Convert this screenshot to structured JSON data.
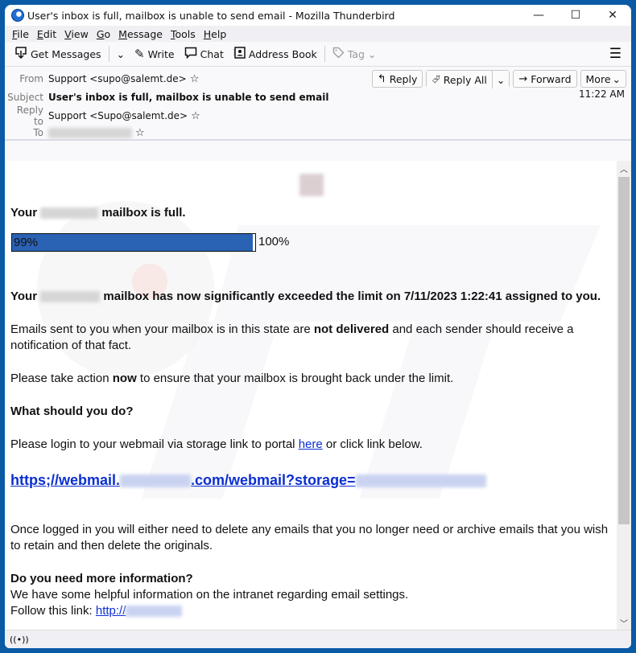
{
  "window": {
    "title": "User's inbox is full, mailbox is unable to send email - Mozilla Thunderbird",
    "controls": {
      "minimize": "—",
      "maximize": "☐",
      "close": "✕"
    }
  },
  "menubar": [
    {
      "label": "File",
      "accel": "F",
      "rest": "ile"
    },
    {
      "label": "Edit",
      "accel": "E",
      "rest": "dit"
    },
    {
      "label": "View",
      "accel": "V",
      "rest": "iew"
    },
    {
      "label": "Go",
      "accel": "G",
      "rest": "o"
    },
    {
      "label": "Message",
      "accel": "M",
      "rest": "essage"
    },
    {
      "label": "Tools",
      "accel": "T",
      "rest": "ools"
    },
    {
      "label": "Help",
      "accel": "H",
      "rest": "elp"
    }
  ],
  "toolbar": {
    "get_messages": "Get Messages",
    "write": "Write",
    "chat": "Chat",
    "address_book": "Address Book",
    "tag": "Tag"
  },
  "header": {
    "from_label": "From",
    "from_value": "Support <supo@salemt.de>",
    "subject_label": "Subject",
    "subject_value": "User's inbox is full, mailbox is unable to send email",
    "replyto_label": "Reply to",
    "replyto_value": "Support <Supo@salemt.de>",
    "to_label": "To",
    "to_value_redacted": true,
    "time": "11:22 AM",
    "actions": {
      "reply": "Reply",
      "reply_all": "Reply All",
      "forward": "Forward",
      "more": "More"
    }
  },
  "message": {
    "line1_prefix": "Your",
    "line1_suffix": "mailbox is full.",
    "progress": {
      "label": "99%",
      "percent": 99,
      "max_label": "100%",
      "color": "#2a62b4"
    },
    "line2_prefix": "Your",
    "line2_suffix": "mailbox has now significantly exceeded the limit on 7/11/2023 1:22:41 assigned to you.",
    "para1_a": "Emails sent to you when your mailbox is in this state are ",
    "para1_bold": "not delivered",
    "para1_b": " and each sender should receive a notification of that fact.",
    "para2_a": "Please take action ",
    "para2_bold": "now",
    "para2_b": " to ensure that your mailbox is brought back under the limit.",
    "heading1": "What should you do?",
    "para3_a": "Please login to your webmail via storage link to portal ",
    "para3_link": "here",
    "para3_b": " or click link below.",
    "biglink_a": "https;//webmail.",
    "biglink_b": ".com/webmail?storage=",
    "para4": "Once logged in you will either need to delete any emails that you no longer need or archive emails that you wish to retain and then delete the originals.",
    "heading2": "Do you need more information?",
    "para5": "We have some helpful information on the intranet regarding email settings.",
    "para6_a": "Follow this link: ",
    "para6_link": "http://"
  },
  "colors": {
    "link": "#0a2fd0",
    "window_frame": "#0a5aa6"
  }
}
